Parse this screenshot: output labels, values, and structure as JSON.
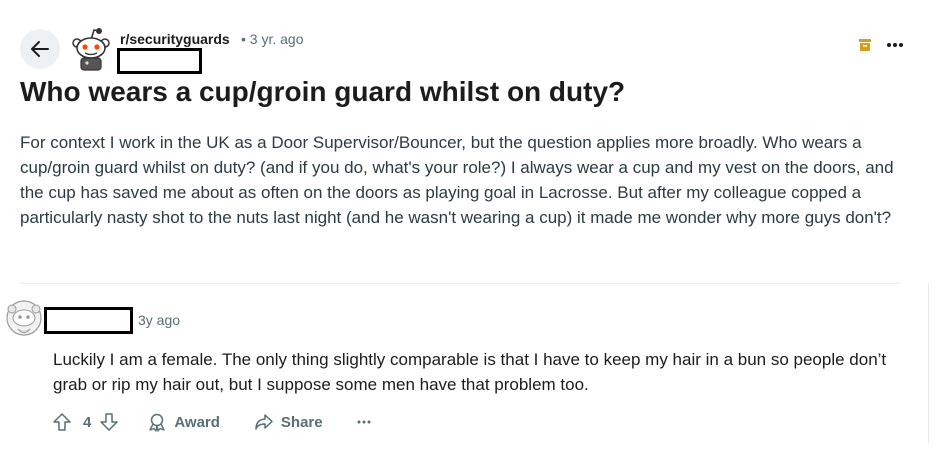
{
  "post": {
    "subreddit": "r/securityguards",
    "meta": "• 3 yr. ago",
    "title": "Who wears a cup/groin guard whilst on duty?",
    "body": "For context I work in the UK as a Door Supervisor/Bouncer, but the question applies more broadly. Who wears a cup/groin guard whilst on duty? (and if you do, what's your role?) I always wear a cup and my vest on the doors, and the cup has saved me about as often on the doors as playing goal in Lacrosse. But after my colleague copped a particularly nasty shot to the nuts last night (and he wasn't wearing a cup) it made me wonder why more guys don't?"
  },
  "comment": {
    "time": "3y ago",
    "body": "Luckily I am a female. The only thing slightly comparable is that I have to keep my hair in a bun so people don’t grab or rip my hair out, but I suppose some men have that problem too.",
    "score": "4",
    "award_label": "Award",
    "share_label": "Share"
  },
  "colors": {
    "accent_gold": "#d4a017",
    "meta_gray": "#576f76",
    "snoo_red": "#ff4500"
  },
  "icons": [
    "back-arrow-icon",
    "subreddit-snoo-icon",
    "archive-icon",
    "more-icon",
    "upvote-icon",
    "downvote-icon",
    "award-icon",
    "share-icon",
    "more-horizontal-icon"
  ]
}
